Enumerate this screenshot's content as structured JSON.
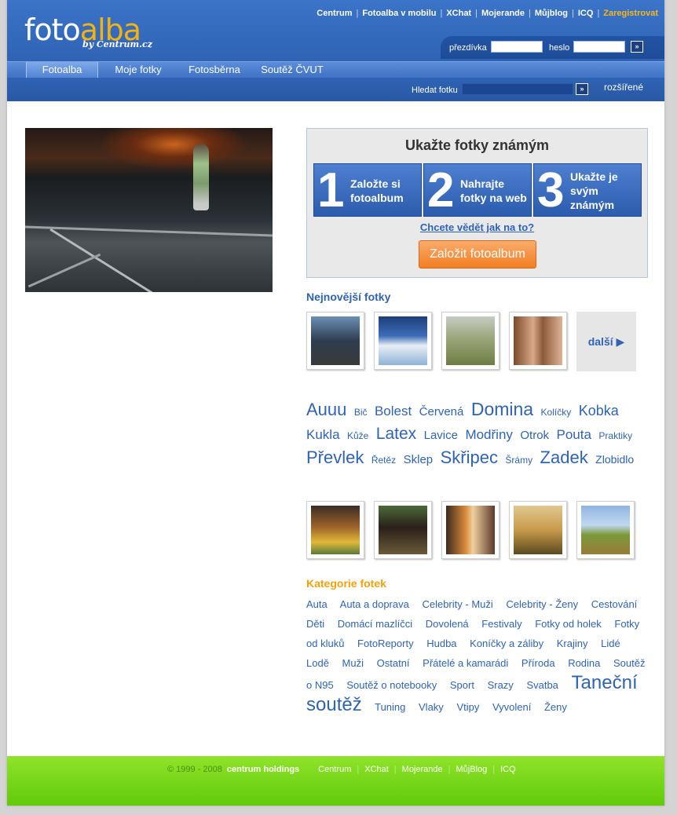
{
  "brand": {
    "foto": "foto",
    "alba": "alba",
    "by": "by Centrum.cz"
  },
  "topnav": {
    "items": [
      "Centrum",
      "Fotoalba v mobilu",
      "XChat",
      "Mojerande",
      "Můjblog",
      "ICQ"
    ],
    "sep": "|",
    "register": "Zaregistrovat"
  },
  "login": {
    "nick_label": "přezdívka",
    "pass_label": "heslo",
    "go": "»"
  },
  "mainnav": {
    "tabs": [
      "Fotoalba",
      "Moje fotky",
      "Fotosběrna",
      "Soutěž ČVUT"
    ]
  },
  "search": {
    "label": "Hledat fotku",
    "go": "»",
    "advanced": "rozšířené"
  },
  "promo": {
    "title": "Ukažte fotky známým",
    "steps": [
      {
        "num": "1",
        "text": "Založte si fotoalbum"
      },
      {
        "num": "2",
        "text": "Nahrajte fotky na web"
      },
      {
        "num": "3",
        "text": "Ukažte je svým známým"
      }
    ],
    "howto": "Chcete vědět jak na to?",
    "button": "Založit fotoalbum"
  },
  "newest": {
    "title": "Nejnovější fotky",
    "more": "další ▶"
  },
  "tags": [
    {
      "text": "Auuu",
      "size": 22
    },
    {
      "text": "Bič",
      "size": 12
    },
    {
      "text": "Bolest",
      "size": 17
    },
    {
      "text": "Červená",
      "size": 15
    },
    {
      "text": "Domina",
      "size": 23
    },
    {
      "text": "Kolíčky",
      "size": 12
    },
    {
      "text": "Kobka",
      "size": 18
    },
    {
      "text": "Kukla",
      "size": 17
    },
    {
      "text": "Kůže",
      "size": 12
    },
    {
      "text": "Latex",
      "size": 21
    },
    {
      "text": "Lavice",
      "size": 15
    },
    {
      "text": "Modřiny",
      "size": 17
    },
    {
      "text": "Otrok",
      "size": 15
    },
    {
      "text": "Pouta",
      "size": 17
    },
    {
      "text": "Praktiky",
      "size": 12
    },
    {
      "text": "Převlek",
      "size": 22
    },
    {
      "text": "Řetěz",
      "size": 12
    },
    {
      "text": "Sklep",
      "size": 15
    },
    {
      "text": "Skřipec",
      "size": 22
    },
    {
      "text": "Šrámy",
      "size": 12
    },
    {
      "text": "Zadek",
      "size": 22
    },
    {
      "text": "Zlobidlo",
      "size": 14
    }
  ],
  "categories": {
    "title": "Kategorie fotek",
    "items": [
      "Auta",
      "Auta a doprava",
      "Celebrity - Muži",
      "Celebrity - Ženy",
      "Cestování",
      "Děti",
      "Domácí mazlíčci",
      "Dovolená",
      "Festivaly",
      "Fotky od holek",
      "Fotky od kluků",
      "FotoReporty",
      "Hudba",
      "Koníčky a záliby",
      "Krajiny",
      "Lidé",
      "Lodě",
      "Muži",
      "Ostatní",
      "Přátelé a kamarádi",
      "Příroda",
      "Rodina",
      "Soutěž o N95",
      "Soutěž o notebooky",
      "Sport",
      "Srazy",
      "Svatba",
      "Taneční soutěž",
      "Tuning",
      "Vlaky",
      "Vtipy",
      "Vyvolení",
      "Ženy"
    ],
    "big_item": "Taneční soutěž"
  },
  "footer": {
    "copy": "© 1999 - 2008",
    "brand": "centrum holdings",
    "links": [
      "Centrum",
      "XChat",
      "Mojerande",
      "MůjBlog",
      "ICQ"
    ],
    "sep": "|"
  },
  "colors": {
    "link": "#2f63b4",
    "accent": "#f6a10b",
    "header": "#2f63b4",
    "footer": "#6fd016"
  }
}
